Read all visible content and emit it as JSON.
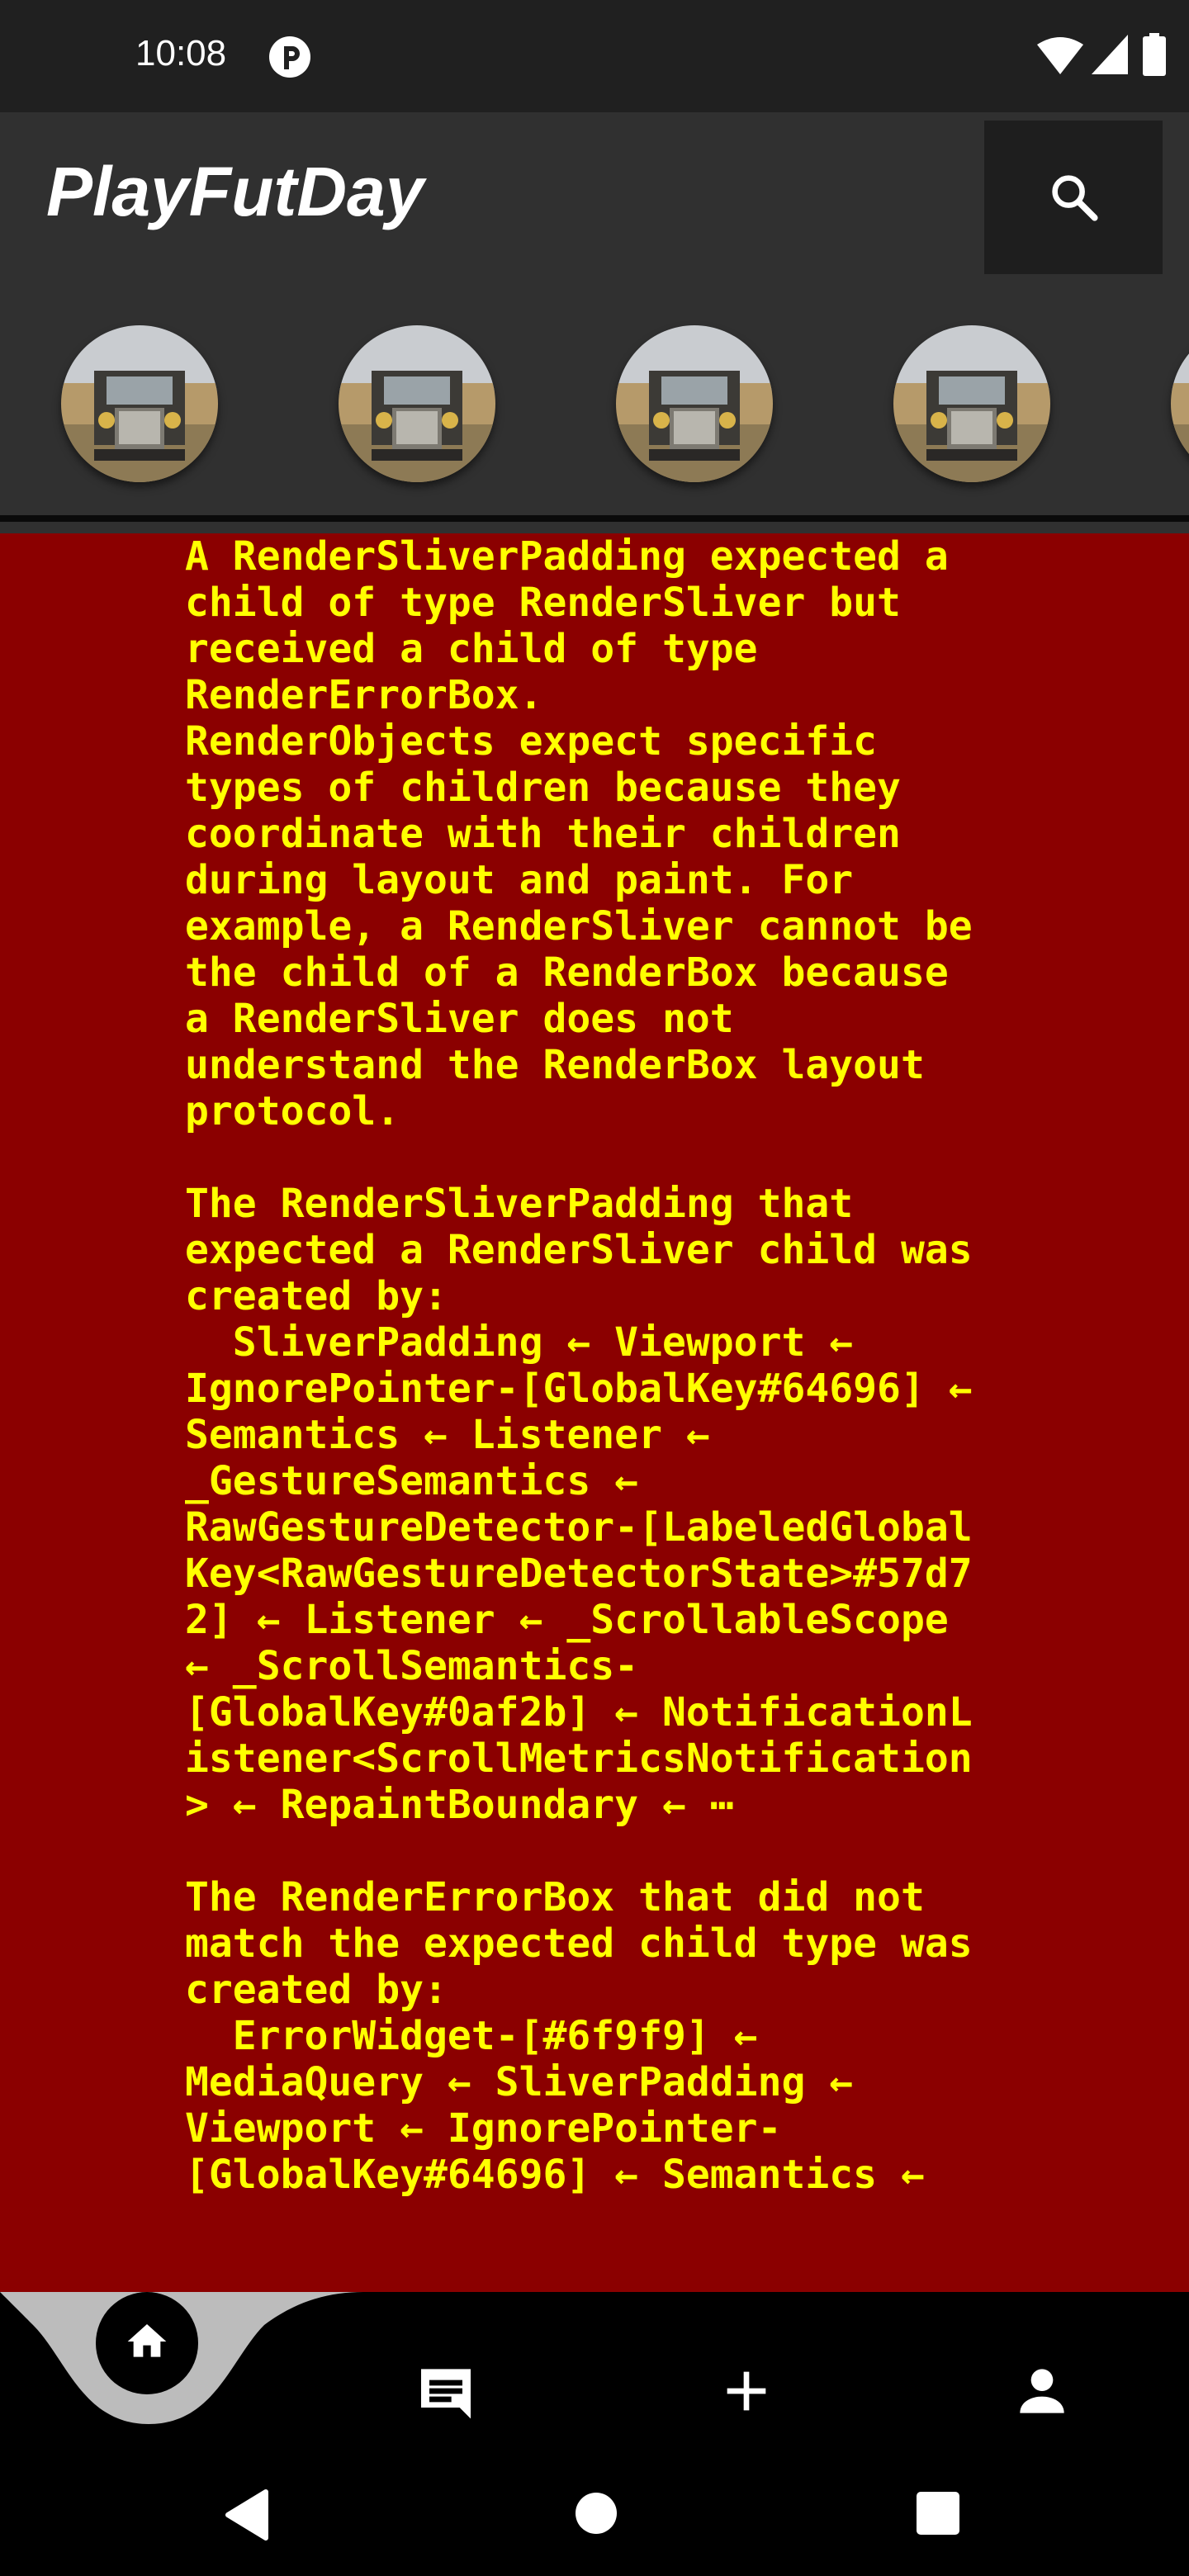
{
  "status_bar": {
    "time": "10:08",
    "icons": [
      "app-notification-icon",
      "wifi-icon",
      "cell-signal-icon",
      "battery-icon"
    ]
  },
  "app_bar": {
    "title": "PlayFutDay",
    "search_icon": "search-icon"
  },
  "stories": {
    "avatar_count": 5
  },
  "error": {
    "text": "A RenderSliverPadding expected a\nchild of type RenderSliver but\nreceived a child of type\nRenderErrorBox.\nRenderObjects expect specific\ntypes of children because they\ncoordinate with their children\nduring layout and paint. For\nexample, a RenderSliver cannot be\nthe child of a RenderBox because\na RenderSliver does not\nunderstand the RenderBox layout\nprotocol.\n\nThe RenderSliverPadding that\nexpected a RenderSliver child was\ncreated by:\n  SliverPadding ← Viewport ←\nIgnorePointer-[GlobalKey#64696] ←\nSemantics ← Listener ←\n_GestureSemantics ←\nRawGestureDetector-[LabeledGlobal\nKey<RawGestureDetectorState>#57d7\n2] ← Listener ← _ScrollableScope\n← _ScrollSemantics-\n[GlobalKey#0af2b] ← NotificationL\nistener<ScrollMetricsNotification\n> ← RepaintBoundary ← ⋯\n\nThe RenderErrorBox that did not\nmatch the expected child type was\ncreated by:\n  ErrorWidget-[#6f9f9] ←\nMediaQuery ← SliverPadding ←\nViewport ← IgnorePointer-\n[GlobalKey#64696] ← Semantics ←",
    "background": "#8b0000",
    "text_color": "#ffff00"
  },
  "bottom_nav": {
    "items": [
      {
        "name": "home",
        "icon": "home-icon",
        "selected": true
      },
      {
        "name": "messages",
        "icon": "chat-icon"
      },
      {
        "name": "add",
        "icon": "plus-icon"
      },
      {
        "name": "profile",
        "icon": "person-icon"
      }
    ]
  },
  "system_nav": [
    "back-icon",
    "home-circle-icon",
    "recents-icon"
  ]
}
